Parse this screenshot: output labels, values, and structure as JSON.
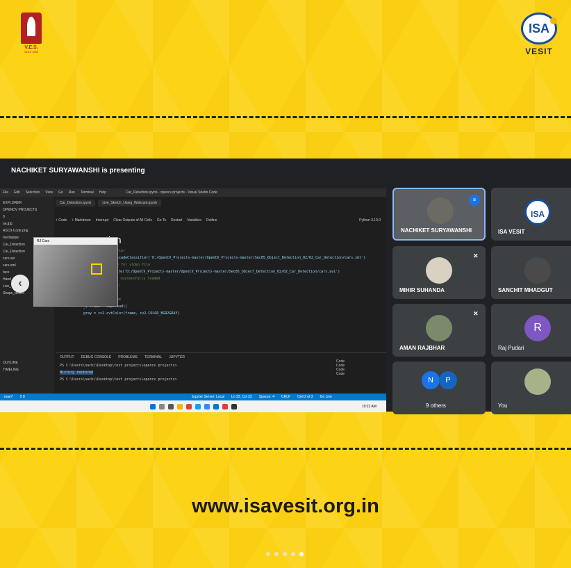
{
  "branding": {
    "ves_text": "V.E.S.",
    "ves_since": "Since 1959",
    "isa_text": "ISA",
    "isa_sub": "VESIT",
    "website": "www.isavesit.org.in"
  },
  "meeting": {
    "presenting_label": "NACHIKET SURYAWANSHI is presenting",
    "participants": [
      {
        "name": "NACHIKET SURYAWANSHI",
        "speaking": true
      },
      {
        "name": "ISA VESIT"
      },
      {
        "name": "MIHIR SUHANDA",
        "muted": true
      },
      {
        "name": "SANCHIT MHADGUT",
        "muted": true
      },
      {
        "name": "AMAN RAJBHAR",
        "muted": true
      },
      {
        "name": "Raj Pudari",
        "initial": "R",
        "muted": true
      },
      {
        "name": "9 others",
        "initials": [
          "N",
          "P"
        ]
      },
      {
        "name": "You"
      }
    ]
  },
  "shared_screen": {
    "window_title": "Car_Detection.ipynb - opencv projects - Visual Studio Code",
    "menu": [
      "File",
      "Edit",
      "Selection",
      "View",
      "Go",
      "Run",
      "Terminal",
      "Help"
    ],
    "explorer_title": "EXPLORER",
    "explorer_items": [
      "OPENCV PROJECTS",
      "0",
      "aa.jpg",
      "ASCII-Code.png",
      "mediapipe",
      "Car_Detection",
      "Car_Detection",
      "cars.avi",
      "cars.xml",
      "face",
      "Hand_tracker",
      "Live_Sketch",
      "Shape_detect",
      "OUTLINE",
      "TIMELINE"
    ],
    "tabs": [
      "Car_Detection.ipynb",
      "Live_Sketch_Using_Webcam.ipynb"
    ],
    "toolbar": [
      "+ Code",
      "+ Markdown",
      "Interrupt",
      "Clear Outputs of All Cells",
      "Go To",
      "Restart",
      "Variables",
      "Outline"
    ],
    "kernel": "Python 3.10.0",
    "cell_title": "ction",
    "camera_window_title": "RJ Cars",
    "code_lines": [
      "classifier",
      "cv2.CascadeClassifier('D:/OpenCV_Projects-master/OpenCV_Projects-master/Sec05_Object_Detection_02/02_Car_Detection/cars.xml')",
      "capture for video file",
      "cap = cv2.VideoCapture('D:/OpenCV_Projects-master/OpenCV_Projects-master/Sec05_Object_Detection_02/02_Car_Detection/cars.avi')",
      "# Loop once video is successfully loaded",
      "while cap.isOpened():",
      "    time.sleep(.05)",
      "    # Read first frame",
      "    _, frame = cap.read()",
      "    gray = cv2.cvtColor(frame, cv2.COLOR_BGR2GRAY)"
    ],
    "terminal_tabs": [
      "OUTPUT",
      "DEBUG CONSOLE",
      "PROBLEMS",
      "TERMINAL",
      "JUPYTER"
    ],
    "terminal_lines": [
      "PS C:\\Users\\nachi\\Desktop\\test projects\\opencv projects>",
      "History restored",
      "PS C:\\Users\\nachi\\Desktop\\test projects\\opencv projects>"
    ],
    "code_list": [
      "Code",
      "Code",
      "Code",
      "Code"
    ],
    "status": [
      "main*",
      "0 0",
      "Jupyter Server: Local",
      "Ln 22, Col 22",
      "Spaces: 4",
      "CRLF",
      "Cell 2 of 3",
      "Go Live"
    ],
    "clock": "19:22 AM"
  },
  "carousel": {
    "count": 5,
    "active": 4
  }
}
